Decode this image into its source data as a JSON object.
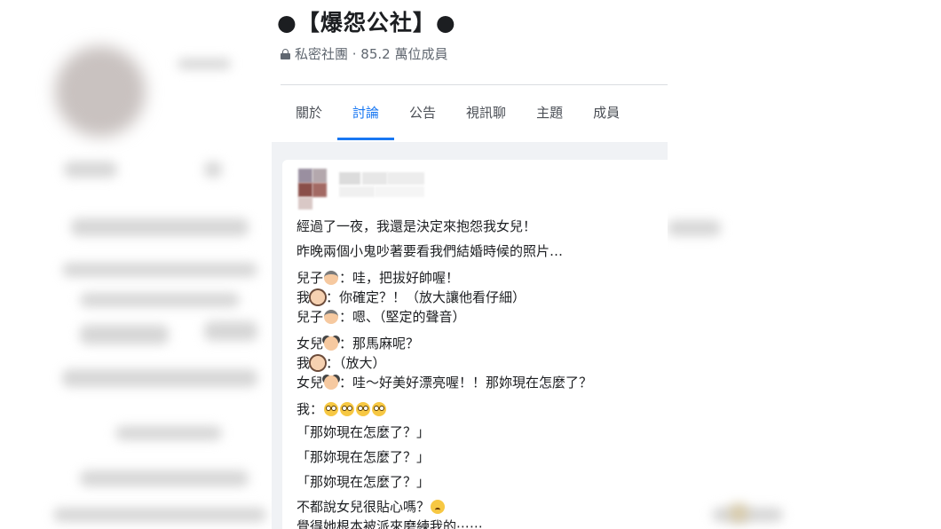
{
  "group": {
    "title": "●【爆怨公社】●",
    "meta": "私密社團 · 85.2 萬位成員",
    "lock_icon": "lock-icon"
  },
  "tabs": [
    {
      "label": "關於"
    },
    {
      "label": "討論"
    },
    {
      "label": "公告"
    },
    {
      "label": "視訊聊"
    },
    {
      "label": "主題"
    },
    {
      "label": "成員"
    }
  ],
  "active_tab": "討論",
  "colors": {
    "accent": "#1877f2",
    "feed_bg": "#f0f2f5",
    "text": "#1c1e21",
    "muted": "#606770"
  },
  "post": {
    "p1": "經過了一夜，我還是決定來抱怨我女兒！",
    "p2": "昨晚兩個小鬼吵著要看我們結婚時候的照片…",
    "d1_prefix": "兒子",
    "d1_text": "：哇，把拔好帥喔！",
    "d2_prefix": "我",
    "d2_text": "：你確定？！（放大讓他看仔細）",
    "d3_prefix": "兒子",
    "d3_text": "：嗯、（堅定的聲音）",
    "d4_prefix": "女兒",
    "d4_text": "：那馬麻呢？",
    "d5_prefix": "我",
    "d5_text": "：（放大）",
    "d6_prefix": "女兒",
    "d6_text": "：哇～好美好漂亮喔！！那妳現在怎麼了？",
    "d7_prefix": "我：",
    "q1": "「那妳現在怎麼了？」",
    "q2": "「那妳現在怎麼了？」",
    "q3": "「那妳現在怎麼了？」",
    "end1": "不都說女兒很貼心嗎？",
    "end2": "覺得她根本被派來磨練我的⋯⋯"
  }
}
